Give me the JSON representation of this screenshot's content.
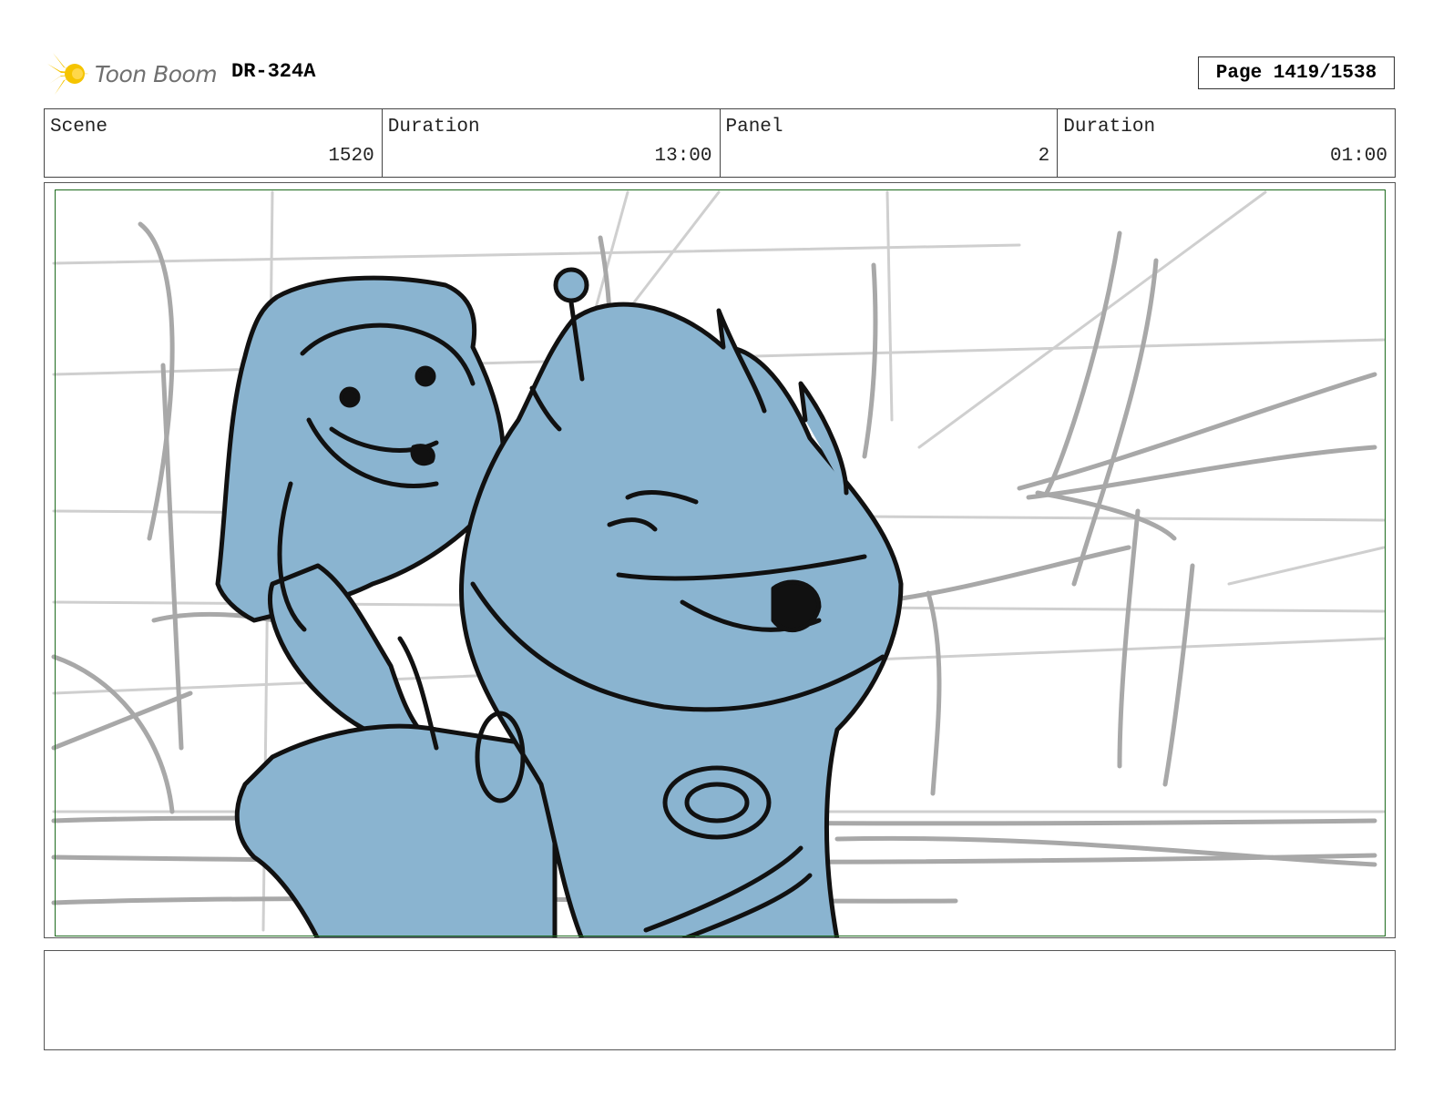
{
  "header": {
    "logo_text": "Toon Boom",
    "doc_code": "DR-324A",
    "page_label": "Page 1419/1538"
  },
  "info": {
    "scene_label": "Scene",
    "scene_value": "1520",
    "scene_duration_label": "Duration",
    "scene_duration_value": "13:00",
    "panel_label": "Panel",
    "panel_value": "2",
    "panel_duration_label": "Duration",
    "panel_duration_value": "01:00"
  },
  "colors": {
    "character_fill": "#8ab4d0",
    "background_sketch": "#a8a8a8",
    "safe_frame": "#1e6b1e",
    "logo_yellow": "#f5c400"
  }
}
